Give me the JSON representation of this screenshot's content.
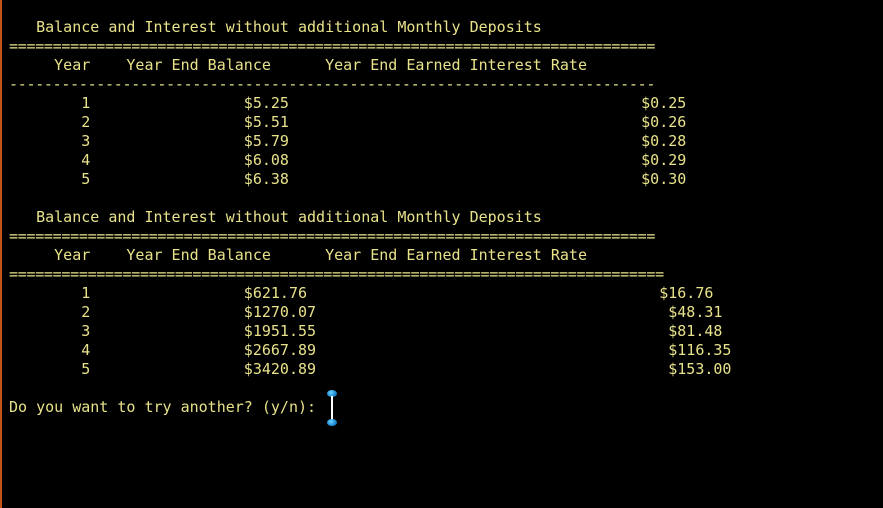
{
  "theme": {
    "background": "#000000",
    "text_color": "#e8e28a",
    "accent_edge": "#c0561a",
    "cursor_handle": "#1f8fd6"
  },
  "table1": {
    "title": "   Balance and Interest without additional Monthly Deposits",
    "rule_top": "==========================================================================",
    "header": "     Year    Year End Balance      Year End Earned Interest Rate",
    "rule_bottom": "--------------------------------------------------------------------------",
    "rows": [
      "        1                 $5.25                                       $0.25",
      "        2                 $5.51                                       $0.26",
      "        3                 $5.79                                       $0.28",
      "        4                 $6.08                                       $0.29",
      "        5                 $6.38                                       $0.30"
    ]
  },
  "table2": {
    "title": "   Balance and Interest without additional Monthly Deposits",
    "rule_top": "==========================================================================",
    "header": "     Year    Year End Balance      Year End Earned Interest Rate",
    "rule_bottom": "===========================================================================",
    "rows": [
      "        1                 $621.76                                       $16.76",
      "        2                 $1270.07                                       $48.31",
      "        3                 $1951.55                                       $81.48",
      "        4                 $2667.89                                       $116.35",
      "        5                 $3420.89                                       $153.00"
    ]
  },
  "prompt": {
    "text": "Do you want to try another? (y/n): "
  },
  "cursor": {
    "icon": "text-cursor-icon"
  }
}
